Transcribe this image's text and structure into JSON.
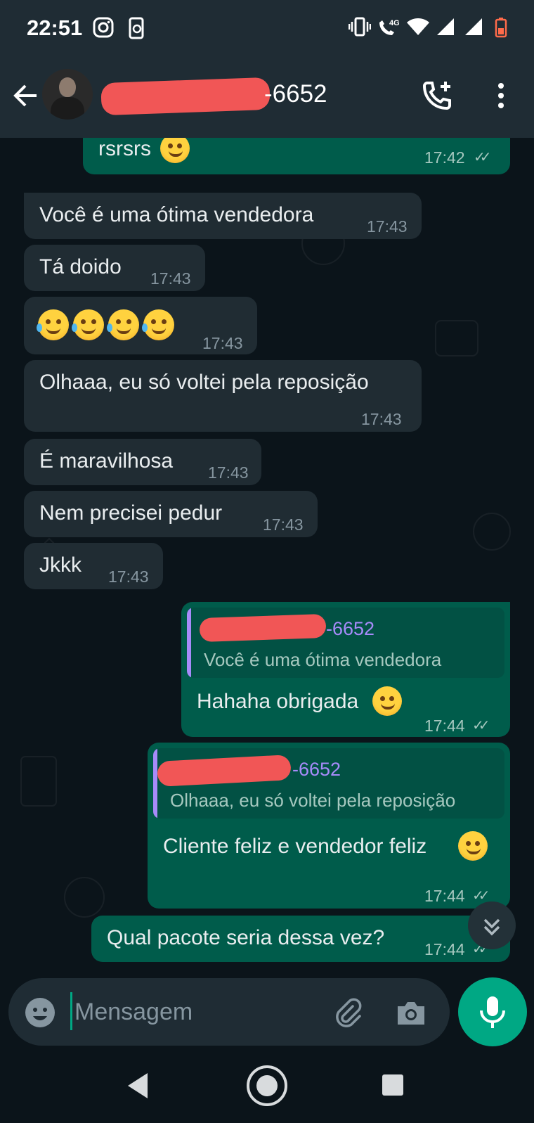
{
  "status_bar": {
    "time": "22:51",
    "icons": [
      "instagram-icon",
      "phone-sync-icon",
      "vibrate-icon",
      "volte-4g-icon",
      "wifi-icon",
      "signal-icon",
      "signal-icon",
      "battery-low-icon"
    ]
  },
  "header": {
    "contact_name_visible": "-6652",
    "icons": [
      "back-arrow-icon",
      "add-call-icon",
      "more-options-icon"
    ]
  },
  "messages": [
    {
      "dir": "out",
      "text": "rsrsrs",
      "time": "17:42",
      "status": "read"
    },
    {
      "dir": "in",
      "text": "Você é uma ótima vendedora",
      "time": "17:43"
    },
    {
      "dir": "in",
      "text": "Tá doido",
      "time": "17:43"
    },
    {
      "dir": "in",
      "text": "",
      "time": "17:43",
      "emoji_count": 4
    },
    {
      "dir": "in",
      "text": "Olhaaa, eu só voltei pela reposição",
      "time": "17:43"
    },
    {
      "dir": "in",
      "text": "É maravilhosa",
      "time": "17:43"
    },
    {
      "dir": "in",
      "text": "Nem precisei pedur",
      "time": "17:43"
    },
    {
      "dir": "in",
      "text": "Jkkk",
      "time": "17:43"
    },
    {
      "dir": "out",
      "quote_name": "-6652",
      "quote_text": "Você é uma ótima vendedora",
      "text": "Hahaha obrigada",
      "time": "17:44",
      "status": "read"
    },
    {
      "dir": "out",
      "quote_name": "-6652",
      "quote_text": "Olhaaa, eu só voltei pela reposição",
      "text": "Cliente feliz e vendedor feliz",
      "time": "17:44",
      "status": "read"
    },
    {
      "dir": "out",
      "text": "Qual pacote seria dessa vez?",
      "time": "17:44",
      "status": "read"
    }
  ],
  "composer": {
    "placeholder": "Mensagem"
  },
  "colors": {
    "header_bg": "#1f2c34",
    "chat_bg": "#0b141a",
    "incoming_bubble": "#202c33",
    "outgoing_bubble": "#005c4b",
    "accent": "#00a884",
    "quote_name": "#a78bfa",
    "redaction": "#f15656"
  }
}
